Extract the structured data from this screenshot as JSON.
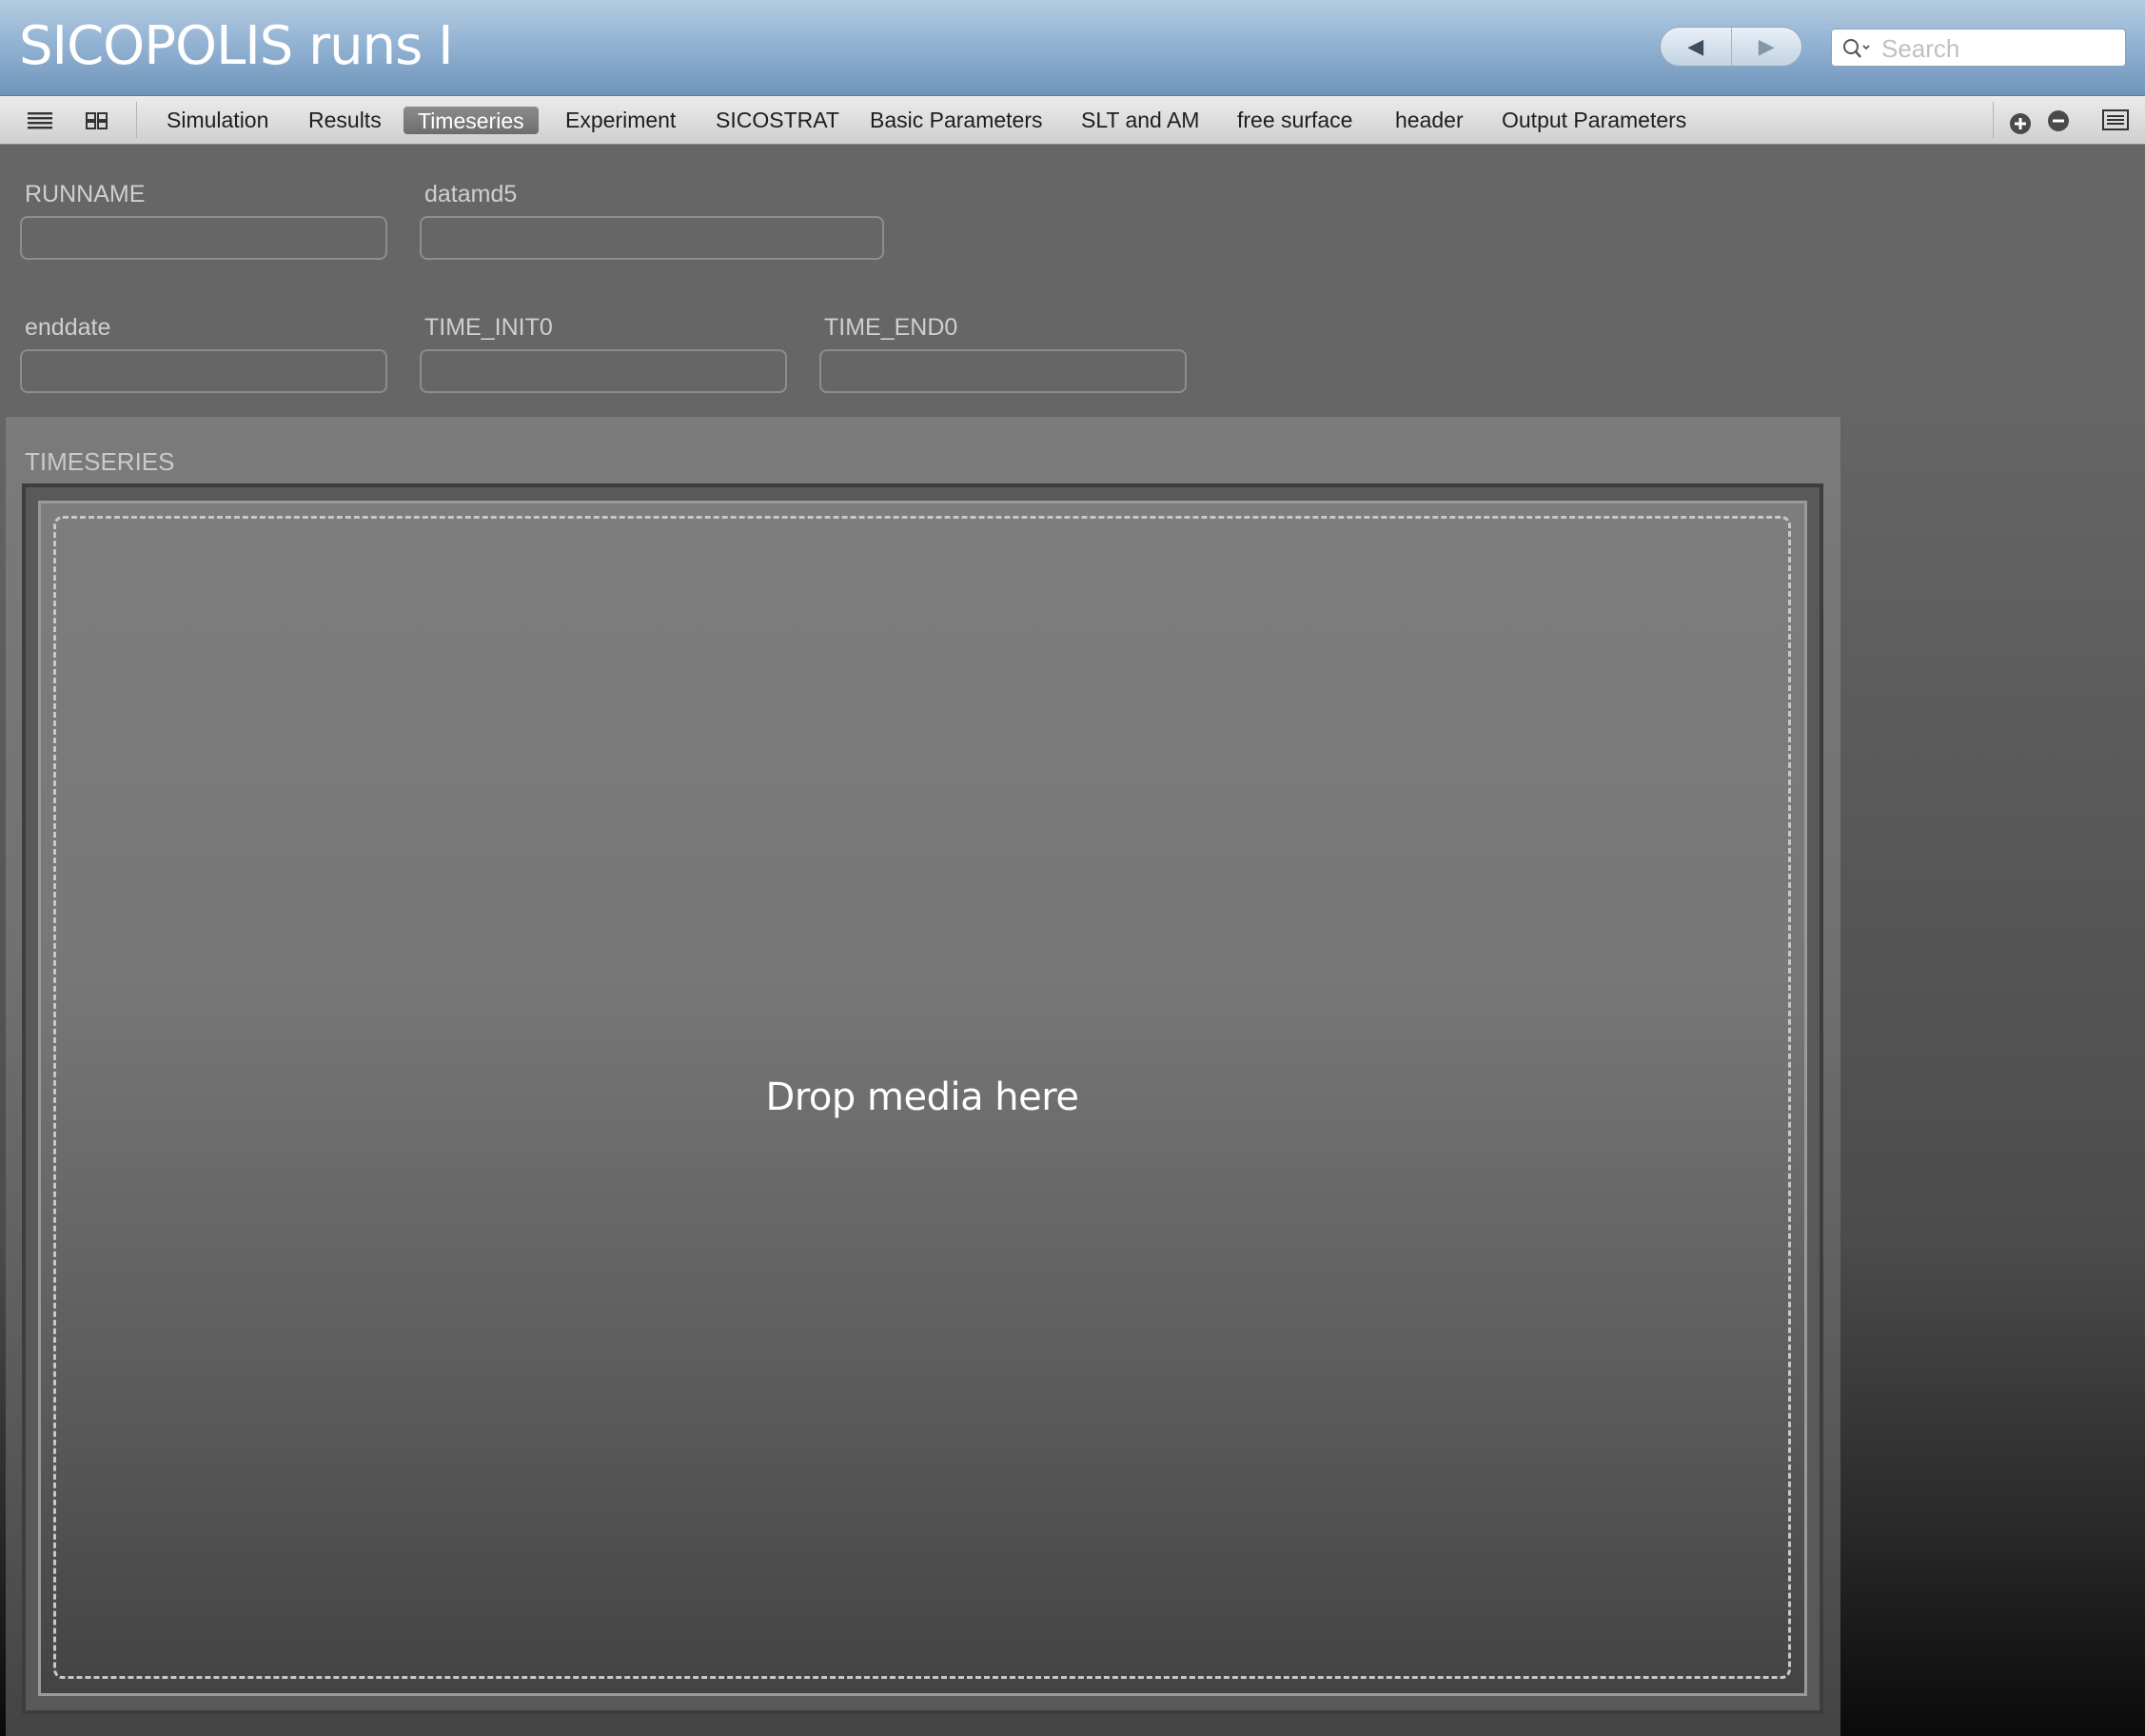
{
  "window": {
    "title": "SICOPOLIS runs  I",
    "nav_back_glyph": "◀",
    "nav_forward_glyph": "▶"
  },
  "search": {
    "placeholder": "Search",
    "value": ""
  },
  "tabs": [
    {
      "label": "Simulation",
      "active": false
    },
    {
      "label": "Results",
      "active": false
    },
    {
      "label": "Timeseries",
      "active": true
    },
    {
      "label": "Experiment",
      "active": false
    },
    {
      "label": "SICOSTRAT",
      "active": false
    },
    {
      "label": "Basic Parameters",
      "active": false
    },
    {
      "label": "SLT and AM",
      "active": false
    },
    {
      "label": "free surface",
      "active": false
    },
    {
      "label": "header",
      "active": false
    },
    {
      "label": "Output Parameters",
      "active": false
    }
  ],
  "fields": {
    "runname": {
      "label": "RUNNAME",
      "value": ""
    },
    "datamd5": {
      "label": "datamd5",
      "value": ""
    },
    "enddate": {
      "label": "enddate",
      "value": ""
    },
    "time_init0": {
      "label": "TIME_INIT0",
      "value": ""
    },
    "time_end0": {
      "label": "TIME_END0",
      "value": ""
    }
  },
  "timeseries": {
    "label": "TIMESERIES",
    "drop_text": "Drop media here"
  },
  "icons": {
    "list_view": "list-view-icon",
    "grid_view": "grid-view-icon",
    "add": "plus-circle-icon",
    "remove": "minus-circle-icon",
    "sidebar": "sidebar-list-icon",
    "search": "magnifier-icon"
  }
}
